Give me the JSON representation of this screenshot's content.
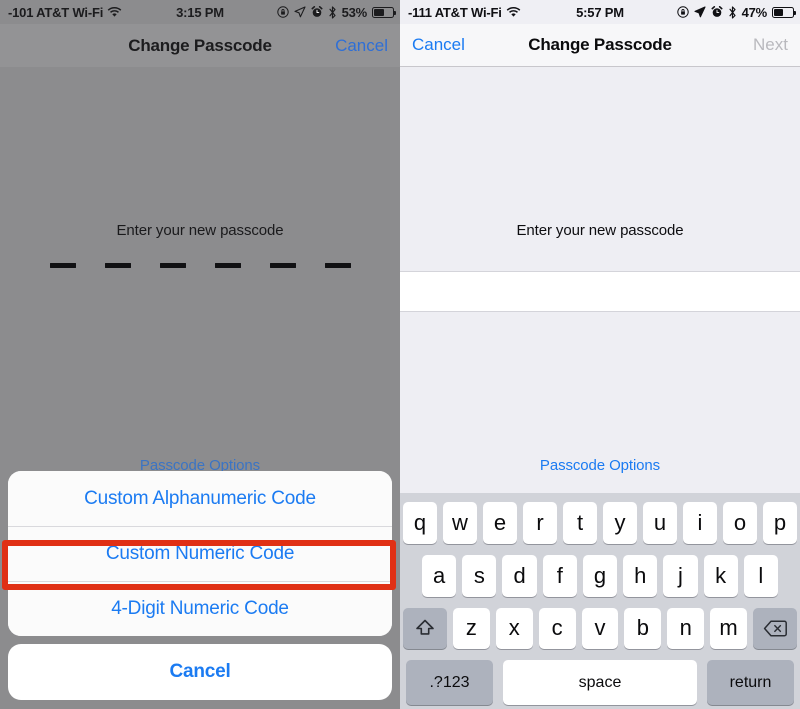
{
  "left": {
    "statusbar": {
      "carrier": "-101 AT&T Wi-Fi",
      "wifi_icon": "wifi-icon",
      "time": "3:15 PM",
      "icons": [
        "rotation-lock-icon",
        "location-arrow-icon",
        "alarm-clock-icon",
        "bluetooth-icon"
      ],
      "battery_pct": "53%",
      "battery_level": 53
    },
    "navbar": {
      "title": "Change Passcode",
      "right_action": "Cancel"
    },
    "prompt": "Enter your new passcode",
    "dash_count": 6,
    "passcode_options": "Passcode Options",
    "action_sheet": {
      "options": [
        "Custom Alphanumeric Code",
        "Custom Numeric Code",
        "4-Digit Numeric Code"
      ],
      "cancel": "Cancel"
    },
    "highlight_color": "#e03015",
    "highlighted_option": "Custom Alphanumeric Code"
  },
  "right": {
    "statusbar": {
      "carrier": "-111 AT&T Wi-Fi",
      "wifi_icon": "wifi-icon",
      "time": "5:57 PM",
      "icons": [
        "rotation-lock-icon",
        "location-arrow-icon",
        "alarm-clock-icon",
        "bluetooth-icon"
      ],
      "battery_pct": "47%",
      "battery_level": 47
    },
    "navbar": {
      "left_action": "Cancel",
      "title": "Change Passcode",
      "right_action": "Next"
    },
    "prompt": "Enter your new passcode",
    "password_field_value": "",
    "passcode_options": "Passcode Options",
    "keyboard": {
      "row1": [
        "q",
        "w",
        "e",
        "r",
        "t",
        "y",
        "u",
        "i",
        "o",
        "p"
      ],
      "row2": [
        "a",
        "s",
        "d",
        "f",
        "g",
        "h",
        "j",
        "k",
        "l"
      ],
      "row3": [
        "z",
        "x",
        "c",
        "v",
        "b",
        "n",
        "m"
      ],
      "shift_key": "shift-icon",
      "backspace_key": "backspace-icon",
      "numbers_key": ".?123",
      "space_key": "space",
      "return_key": "return"
    }
  },
  "colors": {
    "ios_blue": "#1b7bf2",
    "dim_overlay": "#8c8c8e",
    "keyboard_bg": "#d1d3d9",
    "key_dark": "#adb2bd"
  }
}
